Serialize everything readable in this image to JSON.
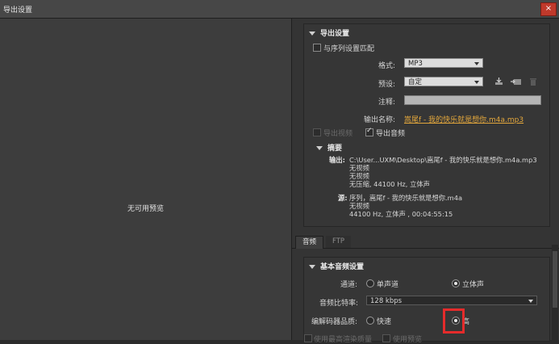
{
  "window": {
    "title": "导出设置",
    "close_symbol": "×"
  },
  "preview": {
    "no_preview": "无可用预览"
  },
  "export_settings": {
    "header": "导出设置",
    "match_sequence": {
      "label": "与序列设置匹配",
      "checked": false
    },
    "format": {
      "label": "格式:",
      "value": "MP3"
    },
    "preset": {
      "label": "预设:",
      "value": "自定"
    },
    "comment": {
      "label": "注释:",
      "value": ""
    },
    "output_name": {
      "label": "输出名称:",
      "value": "嵩尾f - 我的快乐就是想你.m4a.mp3"
    },
    "export_video": {
      "label": "导出视频",
      "checked": false
    },
    "export_audio": {
      "label": "导出音频",
      "checked": true
    }
  },
  "summary": {
    "header": "摘要",
    "output_label": "输出:",
    "output_lines": [
      "C:\\User...UXM\\Desktop\\嵩尾f - 我的快乐就是想你.m4a.mp3",
      "无视频",
      "无视频",
      "无压缩, 44100 Hz, 立体声"
    ],
    "source_label": "源:",
    "source_lines": [
      "序列，嵩尾f - 我的快乐就是想你.m4a",
      "无视频",
      "44100 Hz, 立体声 , 00:04:55:15"
    ]
  },
  "tabs": [
    {
      "label": "音频",
      "active": true
    },
    {
      "label": "FTP",
      "active": false
    }
  ],
  "basic_audio": {
    "header": "基本音频设置",
    "channels": {
      "label": "通道:",
      "mono": "单声道",
      "stereo": "立体声",
      "selected": "stereo"
    },
    "bitrate": {
      "label": "音频比特率:",
      "value": "128 kbps"
    },
    "codec_quality": {
      "label": "编解码器品质:",
      "fast": "快速",
      "high": "高",
      "selected": "high"
    },
    "use_max_render": "使用最高渲染质量",
    "use_preview": "使用预览"
  },
  "colors": {
    "accent": "#e3a73c",
    "highlight": "#e52b2b"
  }
}
